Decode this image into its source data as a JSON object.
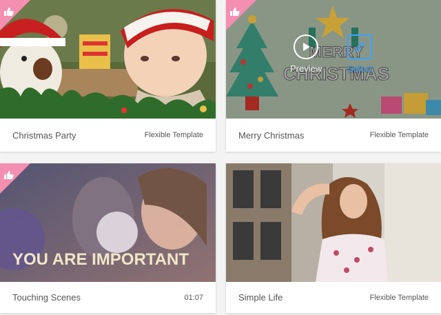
{
  "cards": [
    {
      "title": "Christmas Party",
      "meta": "Flexible Template"
    },
    {
      "title": "Merry Christmas",
      "meta": "Flexible Template",
      "overlay": {
        "preview_label": "Preview",
        "select_label": "Select"
      },
      "art_text": [
        "MERRY",
        "CHRISTMAS"
      ]
    },
    {
      "title": "Touching Scenes",
      "meta": "01:07",
      "art_text": "YOU ARE IMPORTANT"
    },
    {
      "title": "Simple Life",
      "meta": "Flexible Template"
    }
  ],
  "colors": {
    "like_badge": "#f48fb1",
    "select_accent": "#3da0ff"
  },
  "icons": {
    "like": "thumbs-up-icon",
    "preview": "play-icon",
    "select": "edit-icon"
  }
}
